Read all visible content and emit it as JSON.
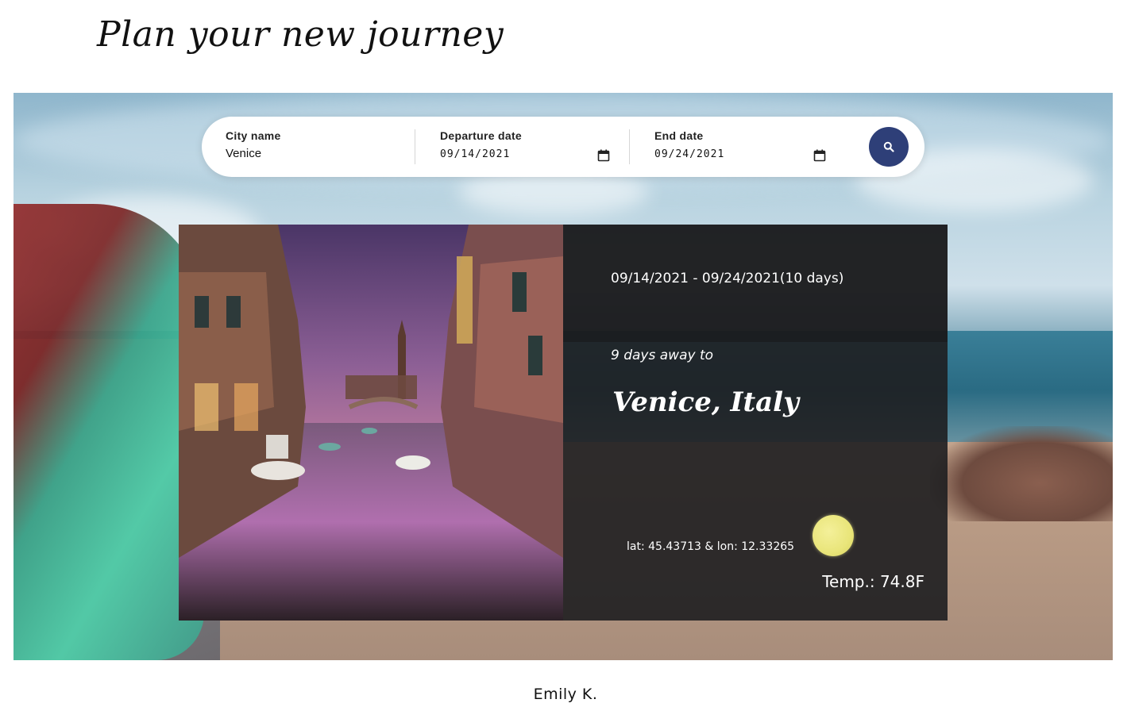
{
  "page": {
    "title": "Plan your new journey"
  },
  "search": {
    "city": {
      "label": "City name",
      "value": "Venice"
    },
    "departure": {
      "label": "Departure date",
      "value": "09/14/2021"
    },
    "end": {
      "label": "End date",
      "value": "09/24/2021"
    },
    "button_icon": "search-icon",
    "button_color": "#2e3f78"
  },
  "result": {
    "dates": "09/14/2021 - 09/24/2021(10 days)",
    "days_away": "9 days away to",
    "destination": "Venice, Italy",
    "coordinates": "lat: 45.43713 & lon: 12.33265",
    "weather_icon": "sun-icon",
    "temperature": "Temp.: 74.8F"
  },
  "footer": {
    "author": "Emily K."
  }
}
